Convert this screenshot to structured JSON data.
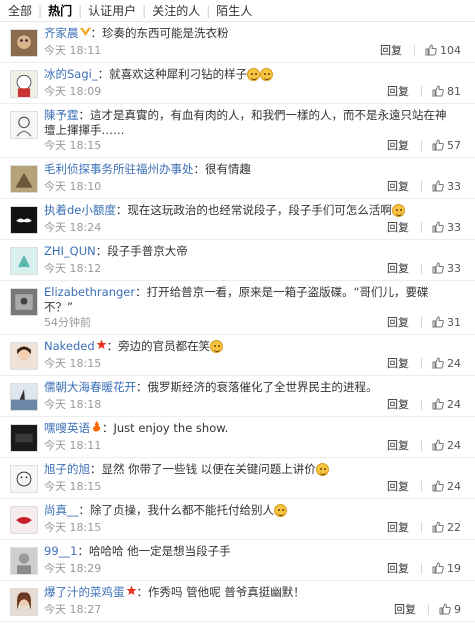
{
  "tabs": [
    "全部",
    "热门",
    "认证用户",
    "关注的人",
    "陌生人"
  ],
  "reply_label": "回复",
  "comments": [
    {
      "name": "齐家晨",
      "badge": "vip",
      "text": "：珍奏的东西可能是洗衣粉",
      "time": "今天 18:11",
      "likes": "104",
      "avatar": "monkey"
    },
    {
      "name": "冰的Sagi_",
      "text": "：就喜欢这种犀利刁钻的样子",
      "emoji": 2,
      "time": "今天 18:09",
      "likes": "81",
      "avatar": "cartoon"
    },
    {
      "name": "陳予霆",
      "text": "：這才是真實的，有血有肉的人，和我們一樣的人，而不是永遠只站在神壇上揮揮手……",
      "time": "今天 18:15",
      "likes": "57",
      "avatar": "sketch"
    },
    {
      "name": "毛利侦探事务所驻福州办事处",
      "text": "：很有情趣",
      "time": "今天 18:10",
      "likes": "33",
      "avatar": "animal"
    },
    {
      "name": "执着de小额度",
      "text": "：现在这玩政治的也经常说段子，段子手们可怎么活啊",
      "emoji": 1,
      "time": "今天 18:24",
      "likes": "33",
      "avatar": "mustache"
    },
    {
      "name": "ZHI_QUN",
      "text": "：段子手普京大帝",
      "time": "今天 18:12",
      "likes": "33",
      "avatar": "teal"
    },
    {
      "name": "Elizabethranger",
      "text": "：打开给普京一看，原来是一箱子盗版碟。“哥们儿，要碟不？”",
      "time": "54分钟前",
      "likes": "31",
      "avatar": "photo"
    },
    {
      "name": "Nakeded",
      "badge": "star",
      "text": "：旁边的官员都在笑",
      "emoji": 1,
      "time": "今天 18:15",
      "likes": "24",
      "avatar": "girl"
    },
    {
      "name": "儒朝大海春暖花开",
      "text": "：俄罗斯经济的衰落催化了全世界民主的进程。",
      "time": "今天 18:18",
      "likes": "24",
      "avatar": "sea"
    },
    {
      "name": "嘿嗖英语",
      "badge": "fire",
      "text": "：Just enjoy the show.",
      "time": "今天 18:11",
      "likes": "24",
      "avatar": "dark"
    },
    {
      "name": "旭子的旭",
      "text": "：显然 你带了一些钱 以便在关键问题上讲价",
      "emoji": 1,
      "time": "今天 18:15",
      "likes": "24",
      "avatar": "face"
    },
    {
      "name": "尚真__",
      "text": "：除了贞操，我什么都不能托付给别人",
      "emoji": 1,
      "time": "今天 18:15",
      "likes": "22",
      "avatar": "lips"
    },
    {
      "name": "99__1",
      "text": "：哈哈哈  他一定是想当段子手",
      "time": "今天 18:29",
      "likes": "19",
      "avatar": "gray"
    },
    {
      "name": "爆了汁的菜鸡蛋",
      "badge": "star",
      "text": "：作秀吗  管他呢  普爷真挺幽默！",
      "time": "今天 18:27",
      "likes": "9",
      "avatar": "woman"
    }
  ],
  "colors": {
    "name": "#3b6fb6",
    "meta": "#999999",
    "badge_vip": "#f5a623",
    "badge_star": "#e8321d"
  }
}
